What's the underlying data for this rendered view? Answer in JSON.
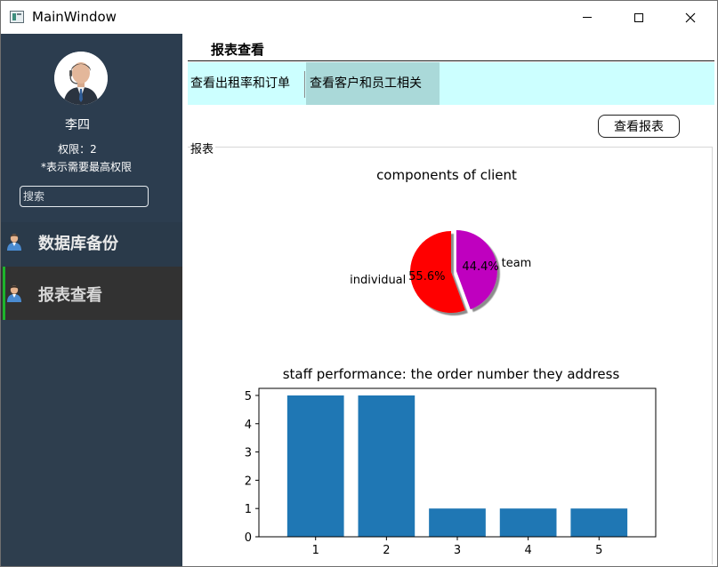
{
  "window": {
    "title": "MainWindow"
  },
  "sidebar": {
    "user_name": "李四",
    "permission": "权限：2",
    "permission_note": "*表示需要最高权限",
    "search_placeholder": "搜索",
    "items": [
      {
        "label": "数据库备份",
        "icon": "user-icon",
        "active": false
      },
      {
        "label": "报表查看",
        "icon": "user-icon",
        "active": true
      }
    ],
    "active_accent": "#1db52b"
  },
  "main": {
    "page_title": "报表查看",
    "tabs": [
      {
        "label": "查看出租率和订单",
        "selected": false
      },
      {
        "label": "查看客户和员工相关",
        "selected": true
      }
    ],
    "view_report_button": "查看报表",
    "group_title": "报表"
  },
  "chart_data": [
    {
      "type": "pie",
      "title": "components of client",
      "slices": [
        {
          "label": "individual",
          "value": 55.6,
          "pct_label": "55.6%",
          "color": "#ff0000"
        },
        {
          "label": "team",
          "value": 44.4,
          "pct_label": "44.4%",
          "color": "#bf00bf",
          "exploded": true
        }
      ],
      "shadow": true
    },
    {
      "type": "bar",
      "title": "staff performance: the order number they address",
      "categories": [
        "1",
        "2",
        "3",
        "4",
        "5"
      ],
      "values": [
        5,
        5,
        1,
        1,
        1
      ],
      "ylim": [
        0,
        5.25
      ],
      "yticks": [
        "0",
        "1",
        "2",
        "3",
        "4",
        "5"
      ],
      "color": "#1f77b4",
      "grid": false
    }
  ]
}
